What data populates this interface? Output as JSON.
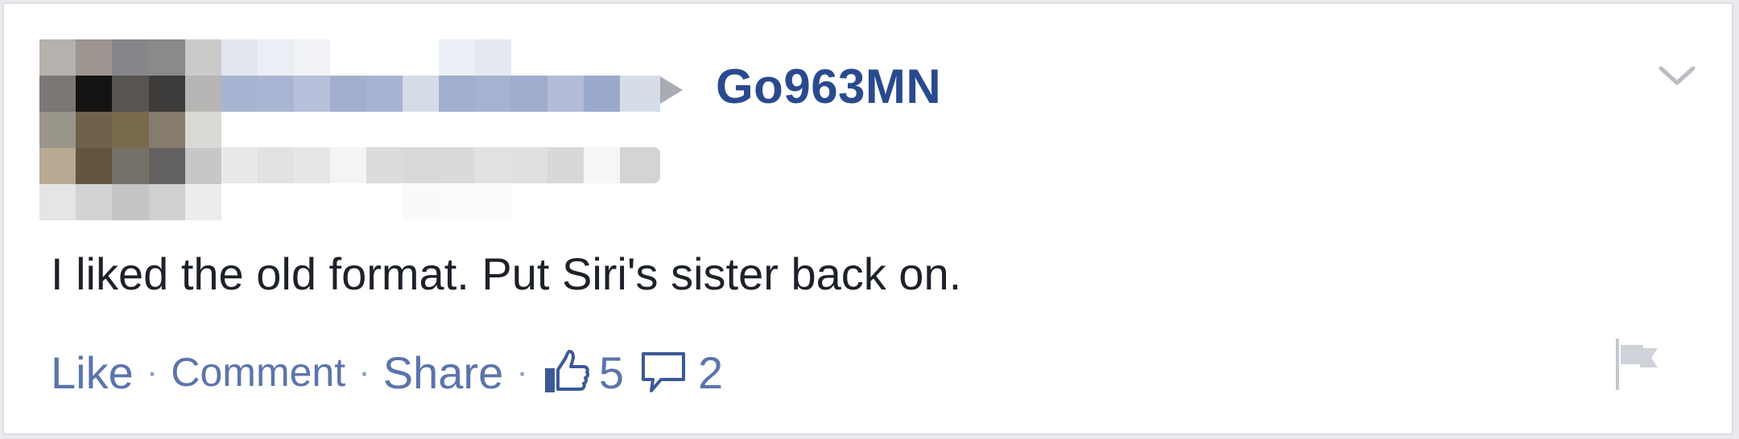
{
  "post": {
    "page_name": "Go963MN",
    "text": "I liked the old format. Put Siri's sister back on."
  },
  "actions": {
    "like_label": "Like",
    "separator": "·",
    "comment_label": "Comment",
    "share_label": "Share",
    "like_count": "5",
    "comment_count": "2"
  },
  "icons": {
    "arrow": "triangle-right-icon",
    "menu": "chevron-down-icon",
    "like": "thumbs-up-icon",
    "comment": "speech-bubble-icon",
    "report": "flag-icon"
  },
  "colors": {
    "link": "#5b74ad",
    "name": "#2a4a8f",
    "text": "#1d2129"
  }
}
